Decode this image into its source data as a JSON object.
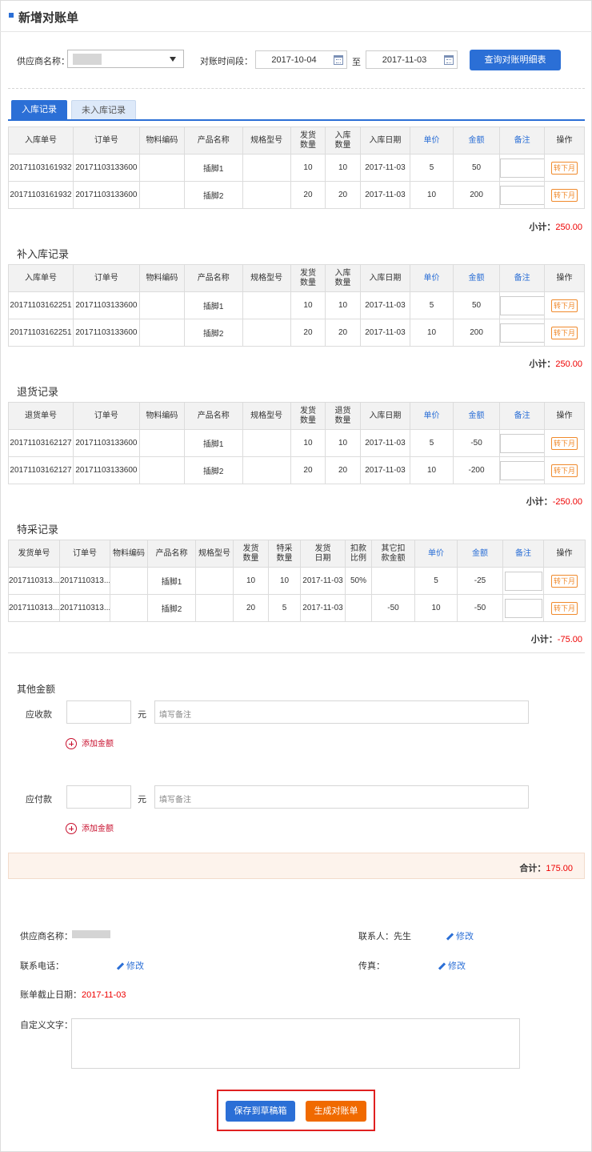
{
  "page": {
    "title": "新增对账单"
  },
  "filters": {
    "supplier_label": "供应商名称：",
    "period_label": "对账时间段：",
    "date_from": "2017-10-04",
    "date_sep": "至",
    "date_to": "2017-11-03",
    "query_button": "查询对账明细表"
  },
  "tabs": [
    {
      "label": "入库记录",
      "active": true
    },
    {
      "label": "未入库记录",
      "active": false
    }
  ],
  "tables": {
    "inbound": {
      "headers": [
        "入库单号",
        "订单号",
        "物料编码",
        "产品名称",
        "规格型号",
        "发货\n数量",
        "入库\n数量",
        "入库日期",
        "单价",
        "金额",
        "备注",
        "操作"
      ],
      "rows": [
        [
          "20171103161932",
          "20171103133600",
          "",
          "插脚1",
          "",
          "10",
          "10",
          "2017-11-03",
          "5",
          "50",
          "",
          "转下月"
        ],
        [
          "20171103161932",
          "20171103133600",
          "",
          "插脚2",
          "",
          "20",
          "20",
          "2017-11-03",
          "10",
          "200",
          "",
          "转下月"
        ]
      ],
      "subtotal_label": "小计：",
      "subtotal_value": "250.00"
    },
    "supplement": {
      "title": "补入库记录",
      "headers": [
        "入库单号",
        "订单号",
        "物料编码",
        "产品名称",
        "规格型号",
        "发货\n数量",
        "入库\n数量",
        "入库日期",
        "单价",
        "金额",
        "备注",
        "操作"
      ],
      "rows": [
        [
          "20171103162251",
          "20171103133600",
          "",
          "插脚1",
          "",
          "10",
          "10",
          "2017-11-03",
          "5",
          "50",
          "",
          "转下月"
        ],
        [
          "20171103162251",
          "20171103133600",
          "",
          "插脚2",
          "",
          "20",
          "20",
          "2017-11-03",
          "10",
          "200",
          "",
          "转下月"
        ]
      ],
      "subtotal_label": "小计：",
      "subtotal_value": "250.00"
    },
    "returns": {
      "title": "退货记录",
      "headers": [
        "退货单号",
        "订单号",
        "物料编码",
        "产品名称",
        "规格型号",
        "发货\n数量",
        "退货\n数量",
        "入库日期",
        "单价",
        "金额",
        "备注",
        "操作"
      ],
      "rows": [
        [
          "20171103162127",
          "20171103133600",
          "",
          "插脚1",
          "",
          "10",
          "10",
          "2017-11-03",
          "5",
          "-50",
          "",
          "转下月"
        ],
        [
          "20171103162127",
          "20171103133600",
          "",
          "插脚2",
          "",
          "20",
          "20",
          "2017-11-03",
          "10",
          "-200",
          "",
          "转下月"
        ]
      ],
      "subtotal_label": "小计：",
      "subtotal_value": "-250.00"
    },
    "special": {
      "title": "特采记录",
      "headers": [
        "发货单号",
        "订单号",
        "物料编码",
        "产品名称",
        "规格型号",
        "发货\n数量",
        "特采\n数量",
        "发货\n日期",
        "扣款\n比例",
        "其它扣\n款金额",
        "单价",
        "金额",
        "备注",
        "操作"
      ],
      "rows": [
        [
          "2017110313...",
          "2017110313...",
          "",
          "插脚1",
          "",
          "10",
          "10",
          "2017-11-03",
          "50%",
          "",
          "5",
          "-25",
          "",
          "转下月"
        ],
        [
          "2017110313...",
          "2017110313...",
          "",
          "插脚2",
          "",
          "20",
          "5",
          "2017-11-03",
          "",
          "-50",
          "10",
          "-50",
          "",
          "转下月"
        ]
      ],
      "subtotal_label": "小计：",
      "subtotal_value": "-75.00"
    }
  },
  "other": {
    "title": "其他金额",
    "receivable_label": "应收款",
    "payable_label": "应付款",
    "unit": "元",
    "note_placeholder": "填写备注",
    "add_label": "添加金额",
    "total_label": "合计：",
    "total_value": "175.00"
  },
  "info": {
    "supplier_label": "供应商名称：",
    "contact_label": "联系人：先生",
    "phone_label": "联系电话：",
    "fax_label": "传真：",
    "edit_label": "修改",
    "cutoff_label": "账单截止日期：",
    "cutoff_value": "2017-11-03",
    "custom_text_label": "自定义文字："
  },
  "actions": {
    "save_draft": "保存到草稿箱",
    "generate": "生成对账单"
  }
}
